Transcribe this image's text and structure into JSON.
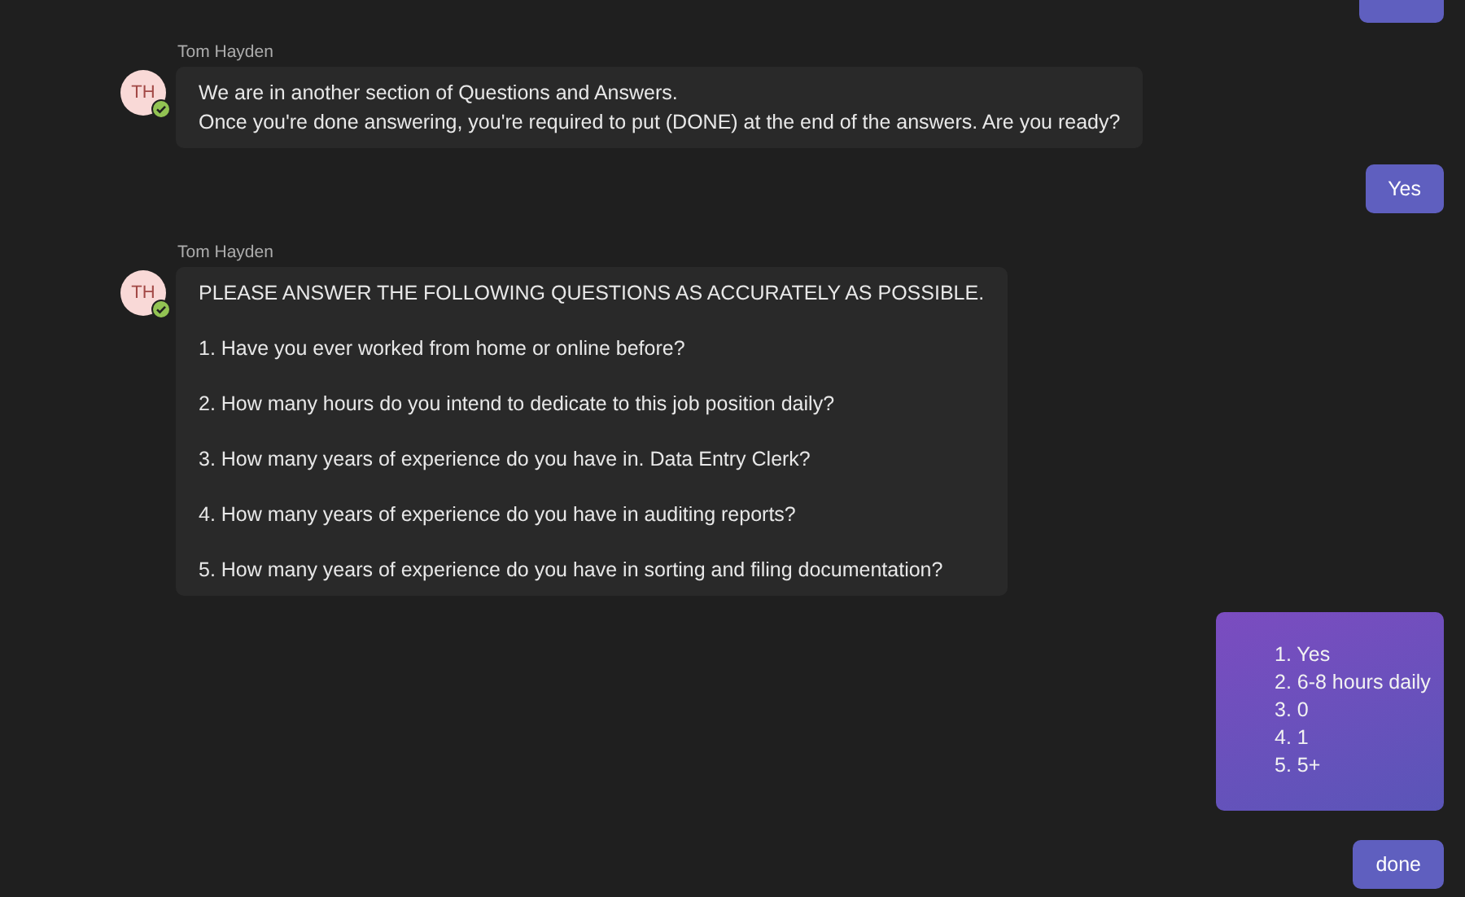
{
  "messages": [
    {
      "kind": "cut_off"
    },
    {
      "kind": "incoming",
      "sender": "Tom Hayden",
      "initials": "TH",
      "lines": [
        "We are in another section of Questions and Answers.",
        "Once you're done answering, you're required to put (DONE) at the end of the answers. Are you ready?"
      ]
    },
    {
      "kind": "outgoing",
      "lines": [
        "Yes"
      ]
    },
    {
      "kind": "questionnaire",
      "sender": "Tom Hayden",
      "initials": "TH",
      "lines": [
        "PLEASE ANSWER THE FOLLOWING QUESTIONS AS ACCURATELY AS POSSIBLE.",
        "1. Have you ever worked from home or online before?",
        "2. How many hours do you intend to dedicate to this job position daily?",
        "3. How many years of experience do you have in. Data Entry Clerk?",
        "4. How many years of experience do you have in auditing reports?",
        "5. How many years of experience do you have in sorting and filing documentation?"
      ]
    },
    {
      "kind": "answers",
      "lines": [
        "1. Yes",
        "2. 6-8 hours daily",
        "3. 0",
        "4. 1",
        "5. 5+"
      ]
    },
    {
      "kind": "outgoing",
      "lines": [
        "done"
      ]
    }
  ]
}
